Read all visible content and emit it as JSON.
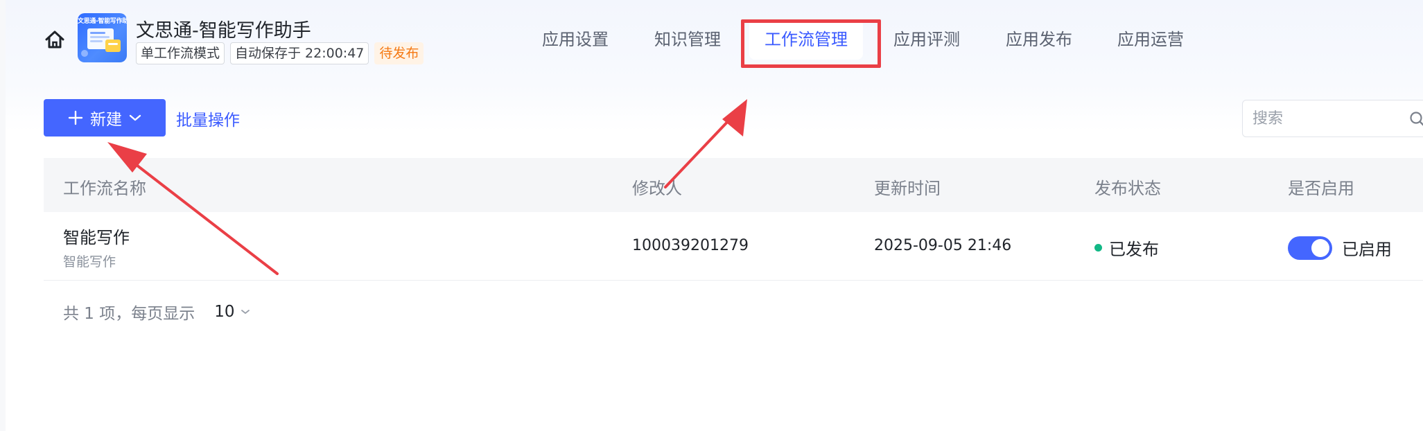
{
  "header": {
    "app_title": "文思通-智能写作助手",
    "logo_text": "文思通-智能写作助",
    "tags": {
      "mode": "单工作流模式",
      "autosave": "自动保存于 22:00:47",
      "status": "待发布"
    }
  },
  "nav": {
    "tabs": [
      "应用设置",
      "知识管理",
      "工作流管理",
      "应用评测",
      "应用发布",
      "应用运营"
    ],
    "active_tab": "工作流管理"
  },
  "toolbar": {
    "new_label": "新建",
    "batch_label": "批量操作",
    "search_placeholder": "搜索"
  },
  "table": {
    "columns": [
      "工作流名称",
      "修改人",
      "更新时间",
      "发布状态",
      "是否启用"
    ],
    "rows": [
      {
        "name": "智能写作",
        "description": "智能写作",
        "modifier": "100039201279",
        "updated_at": "2025-09-05 21:46",
        "status": "已发布",
        "enabled": true,
        "enabled_label": "已启用"
      }
    ]
  },
  "pagination": {
    "summary": "共 1 项，每页显示",
    "page_size": "10"
  },
  "colors": {
    "primary": "#4466ff",
    "annotation_red": "#ea3f46",
    "status_green": "#12b886",
    "pending_orange": "#f57a15"
  }
}
